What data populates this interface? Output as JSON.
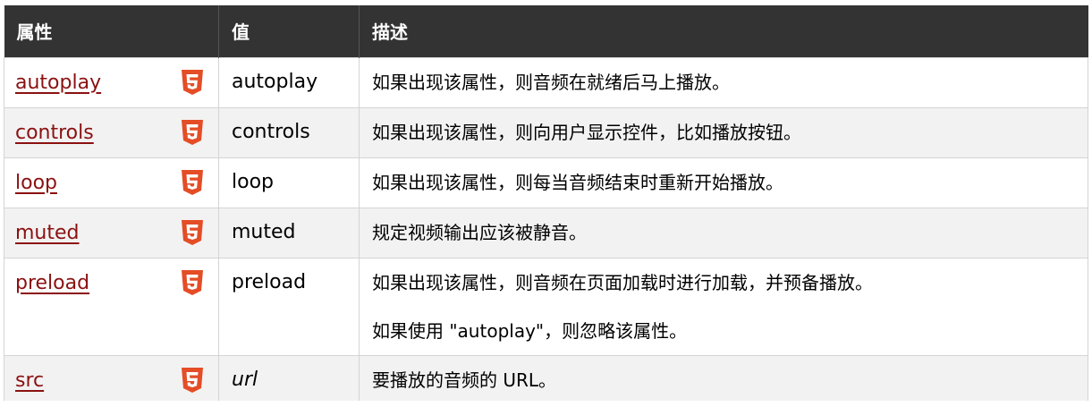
{
  "table": {
    "headers": {
      "attribute": "属性",
      "value": "值",
      "description": "描述"
    },
    "rows": [
      {
        "attribute": "autoplay",
        "value": "autoplay",
        "value_italic": false,
        "description": [
          "如果出现该属性，则音频在就绪后马上播放。"
        ]
      },
      {
        "attribute": "controls",
        "value": "controls",
        "value_italic": false,
        "description": [
          "如果出现该属性，则向用户显示控件，比如播放按钮。"
        ]
      },
      {
        "attribute": "loop",
        "value": "loop",
        "value_italic": false,
        "description": [
          "如果出现该属性，则每当音频结束时重新开始播放。"
        ]
      },
      {
        "attribute": "muted",
        "value": "muted",
        "value_italic": false,
        "description": [
          "规定视频输出应该被静音。"
        ]
      },
      {
        "attribute": "preload",
        "value": "preload",
        "value_italic": false,
        "description": [
          "如果出现该属性，则音频在页面加载时进行加载，并预备播放。",
          "如果使用 \"autoplay\"，则忽略该属性。"
        ]
      },
      {
        "attribute": "src",
        "value": "url",
        "value_italic": true,
        "description": [
          "要播放的音频的 URL。"
        ]
      }
    ],
    "badge_icon": "html5-icon"
  },
  "colors": {
    "header_bg": "#333333",
    "header_text": "#ffffff",
    "link": "#8b1111",
    "html5_badge": "#e44d26",
    "row_alt": "#f2f2f2",
    "border": "#d4d4d4"
  }
}
